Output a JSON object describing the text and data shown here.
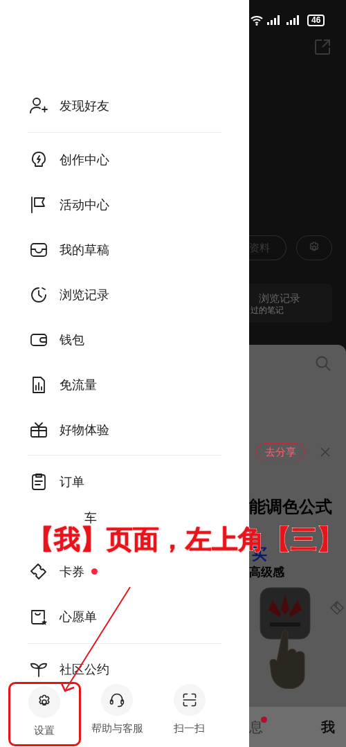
{
  "status_bar": {
    "battery": "46"
  },
  "drawer": {
    "groups": [
      {
        "items": [
          {
            "kind": "person-add",
            "label": "发现好友",
            "badge": false
          }
        ]
      },
      {
        "items": [
          {
            "kind": "bulb",
            "label": "创作中心",
            "badge": false
          },
          {
            "kind": "flag",
            "label": "活动中心",
            "badge": false
          },
          {
            "kind": "tray",
            "label": "我的草稿",
            "badge": false
          },
          {
            "kind": "clock",
            "label": "浏览记录",
            "badge": false
          },
          {
            "kind": "wallet",
            "label": "钱包",
            "badge": false
          },
          {
            "kind": "chart-file",
            "label": "免流量",
            "badge": false
          },
          {
            "kind": "gift",
            "label": "好物体验",
            "badge": false
          }
        ]
      },
      {
        "items": [
          {
            "kind": "clipboard",
            "label": "订单",
            "badge": false
          },
          {
            "kind": "covered",
            "label": "车",
            "badge": false
          },
          {
            "kind": "coupon",
            "label": "卡券",
            "badge": true
          },
          {
            "kind": "wishlist",
            "label": "心愿单",
            "badge": false
          }
        ]
      },
      {
        "items": [
          {
            "kind": "sprout",
            "label": "社区公约",
            "badge": false
          }
        ]
      }
    ],
    "quick_actions": [
      {
        "kind": "gear",
        "label": "设置",
        "highlighted": true
      },
      {
        "kind": "headset",
        "label": "帮助与客服",
        "highlighted": false
      },
      {
        "kind": "scan",
        "label": "扫一扫",
        "highlighted": false
      }
    ]
  },
  "background_page": {
    "profile_button": "资料",
    "history_card": {
      "title": "浏览记录",
      "subtitle": "过的笔记"
    },
    "share_button": "去分享",
    "headline": "能调色公式",
    "headline_2": "买",
    "subheading": "高级感",
    "tab_bar": [
      {
        "label": "息",
        "badge": true,
        "selected": false
      },
      {
        "label": "我",
        "badge": false,
        "selected": true
      }
    ]
  },
  "annotation": {
    "caption": "【我】页面，左上角【三】"
  }
}
